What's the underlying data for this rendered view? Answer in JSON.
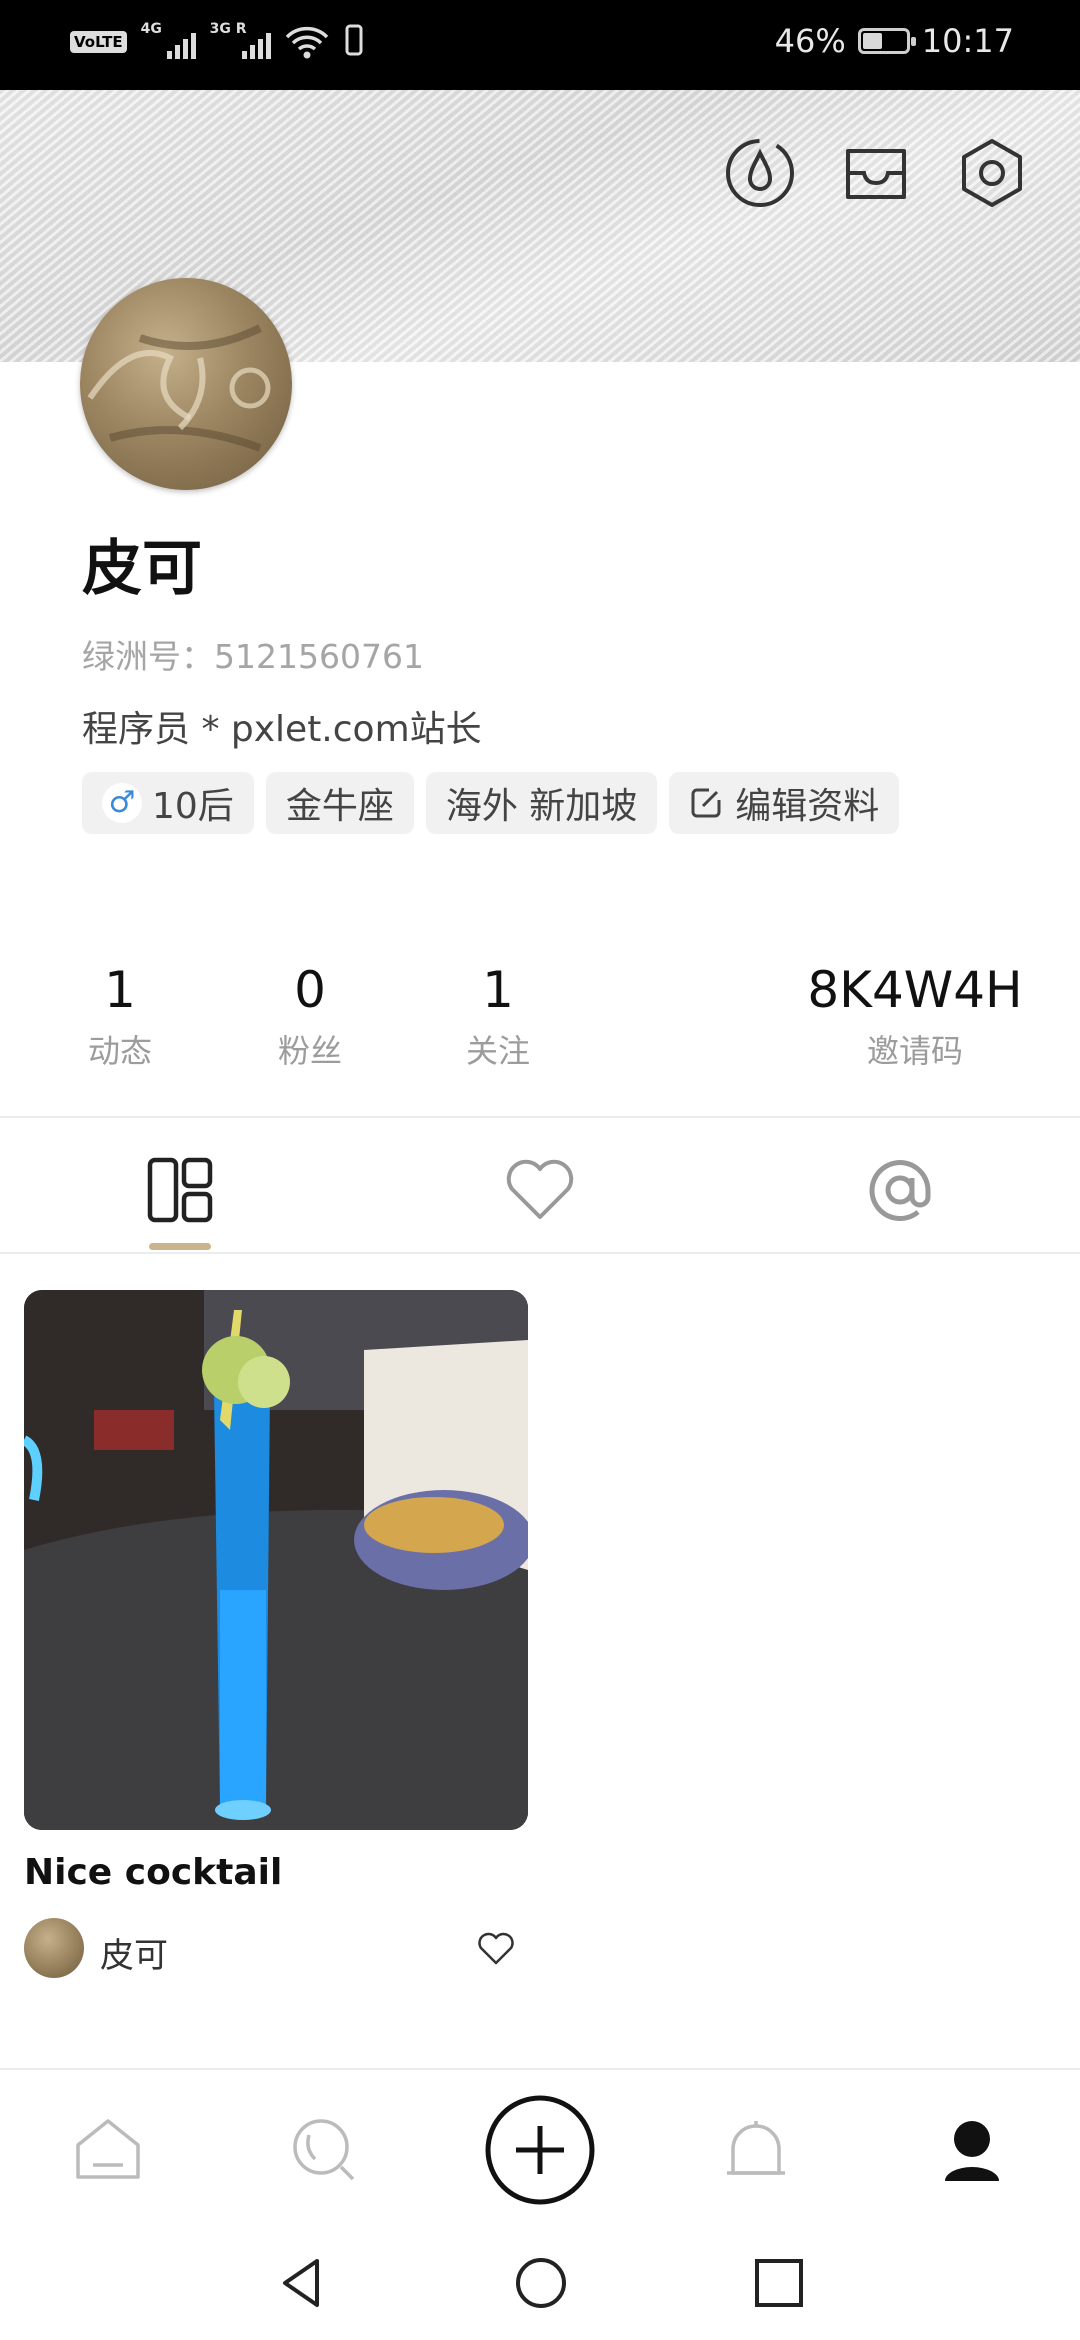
{
  "status_bar": {
    "volte": "VoLTE",
    "network1": "4G",
    "network2": "3G R",
    "battery_percent": "46%",
    "battery_level": 0.46,
    "time": "10:17"
  },
  "header": {
    "icons": [
      "droplet-icon",
      "inbox-icon",
      "settings-icon"
    ]
  },
  "profile": {
    "name": "皮可",
    "oasis_id": "绿洲号：5121560761",
    "bio": "程序员 * pxlet.com站长",
    "tags": {
      "gender_age": "10后",
      "zodiac": "金牛座",
      "location": "海外 新加坡",
      "edit_profile": "编辑资料"
    },
    "gender_symbol": "♂"
  },
  "stats": {
    "posts": {
      "value": "1",
      "label": "动态"
    },
    "fans": {
      "value": "0",
      "label": "粉丝"
    },
    "following": {
      "value": "1",
      "label": "关注"
    },
    "invite": {
      "value": "8K4W4H",
      "label": "邀请码"
    }
  },
  "tabs": [
    "grid-icon",
    "heart-icon",
    "at-icon"
  ],
  "colors": {
    "accent": "#c9b48d",
    "gender_blue": "#3b8ad8"
  },
  "post": {
    "title": "Nice cocktail",
    "author": "皮可"
  },
  "bottom_nav": [
    "home-icon",
    "discover-icon",
    "add-icon",
    "notifications-icon",
    "profile-icon"
  ]
}
